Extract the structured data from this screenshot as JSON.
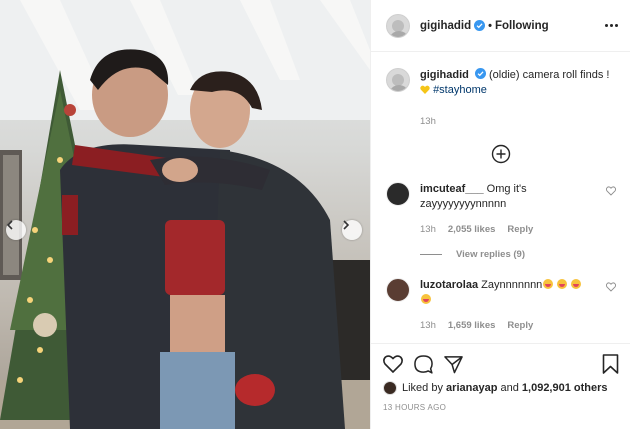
{
  "post": {
    "username": "gigihadid",
    "follow_status": "Following",
    "caption_prefix": "(oldie) camera roll finds !",
    "hashtag": "#stayhome",
    "caption_time": "13h"
  },
  "comments": [
    {
      "username": "imcuteaf___",
      "text": "Omg it's zayyyyyyyynnnnn",
      "time": "13h",
      "likes": "2,055 likes",
      "reply_label": "Reply",
      "view_replies": "View replies (9)"
    },
    {
      "username": "luzotarolaa",
      "text": "Zaynnnnnnn",
      "time": "13h",
      "likes": "1,659 likes",
      "reply_label": "Reply"
    }
  ],
  "footer": {
    "liked_by_prefix": "Liked by",
    "liked_by_user": "arianayap",
    "liked_by_and": "and",
    "liked_by_count": "1,092,901 others",
    "timestamp": "13 HOURS AGO"
  },
  "colors": {
    "verified_blue": "#3897f0",
    "hashtag_blue": "#00376b",
    "muted_text": "#8e8e8e"
  },
  "icons": [
    "verified-badge-icon",
    "more-options-icon",
    "load-more-plus-icon",
    "heart-icon",
    "comment-icon",
    "share-icon",
    "bookmark-icon",
    "chevron-left-icon",
    "chevron-right-icon"
  ]
}
